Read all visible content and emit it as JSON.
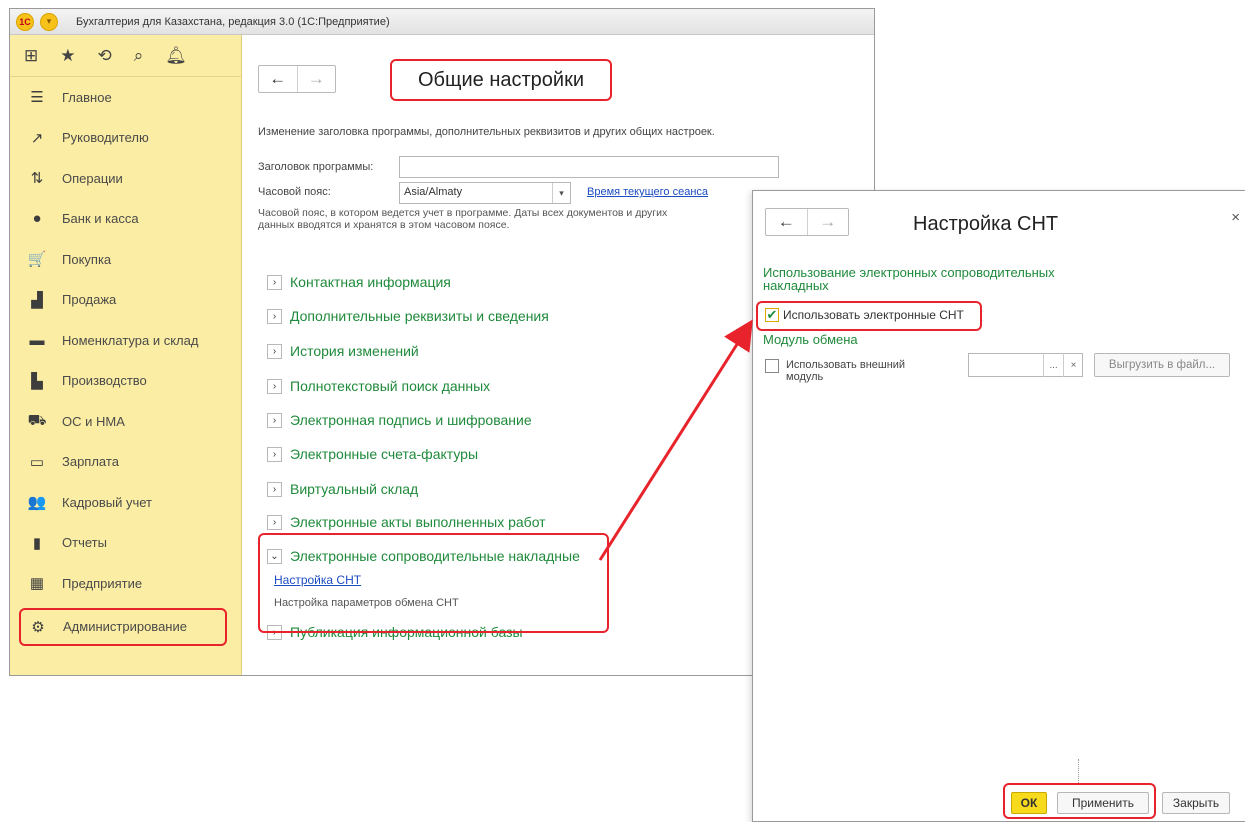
{
  "window": {
    "logo_text": "1C",
    "title": "Бухгалтерия для Казахстана, редакция 3.0  (1С:Предприятие)"
  },
  "sidebar": {
    "toolbar_icons": [
      "grid-icon",
      "star-icon",
      "history-icon",
      "search-icon",
      "bell-icon"
    ],
    "items": [
      {
        "label": "Главное",
        "icon": "hamburger-icon",
        "glyph": "☰"
      },
      {
        "label": "Руководителю",
        "icon": "trend-icon",
        "glyph": "↗"
      },
      {
        "label": "Операции",
        "icon": "operations-icon",
        "glyph": "⇅"
      },
      {
        "label": "Банк и касса",
        "icon": "bank-icon",
        "glyph": "●"
      },
      {
        "label": "Покупка",
        "icon": "cart-icon",
        "glyph": "🛒"
      },
      {
        "label": "Продажа",
        "icon": "bag-icon",
        "glyph": "▟"
      },
      {
        "label": "Номенклатура и склад",
        "icon": "warehouse-icon",
        "glyph": "▬"
      },
      {
        "label": "Производство",
        "icon": "factory-icon",
        "glyph": "▙"
      },
      {
        "label": "ОС и НМА",
        "icon": "truck-icon",
        "glyph": "⛟"
      },
      {
        "label": "Зарплата",
        "icon": "salary-icon",
        "glyph": "▭"
      },
      {
        "label": "Кадровый учет",
        "icon": "people-icon",
        "glyph": "👥"
      },
      {
        "label": "Отчеты",
        "icon": "chart-icon",
        "glyph": "▮"
      },
      {
        "label": "Предприятие",
        "icon": "building-icon",
        "glyph": "▦"
      },
      {
        "label": "Администрирование",
        "icon": "gear-icon",
        "glyph": "⚙"
      }
    ],
    "active_index": 13
  },
  "main": {
    "page_title": "Общие настройки",
    "description": "Изменение заголовка программы, дополнительных реквизитов и других общих настроек.",
    "program_title_label": "Заголовок программы:",
    "program_title_value": "",
    "timezone_label": "Часовой пояс:",
    "timezone_value": "Asia/Almaty",
    "timezone_link": "Время текущего сеанса",
    "timezone_note": "Часовой пояс, в котором ведется учет в программе. Даты всех документов и других данных вводятся и хранятся в этом часовом поясе.",
    "sections": [
      "Контактная информация",
      "Дополнительные реквизиты и сведения",
      "История изменений",
      "Полнотекстовый поиск данных",
      "Электронная подпись и шифрование",
      "Электронные счета-фактуры",
      "Виртуальный склад",
      "Электронные акты выполненных работ",
      "Электронные сопроводительные накладные",
      "Публикация информационной базы"
    ],
    "expanded_section": {
      "link": "Настройка СНТ",
      "description": "Настройка параметров обмена СНТ"
    }
  },
  "dialog": {
    "title": "Настройка СНТ",
    "group_title": "Использование электронных сопроводительных накладных",
    "use_esnt_label": "Использовать электронные СНТ",
    "use_esnt_checked": true,
    "module_title": "Модуль обмена",
    "external_module_label": "Использовать внешний модуль",
    "external_module_checked": false,
    "unload_button": "Выгрузить в файл...",
    "ok_button": "ОК",
    "apply_button": "Применить",
    "close_button": "Закрыть"
  },
  "colors": {
    "sidebar_bg": "#fbeda4",
    "section_green": "#1f8a3b",
    "link_blue": "#1c4cc2",
    "highlight_red": "#e8232c",
    "ok_yellow": "#f7da1c"
  }
}
